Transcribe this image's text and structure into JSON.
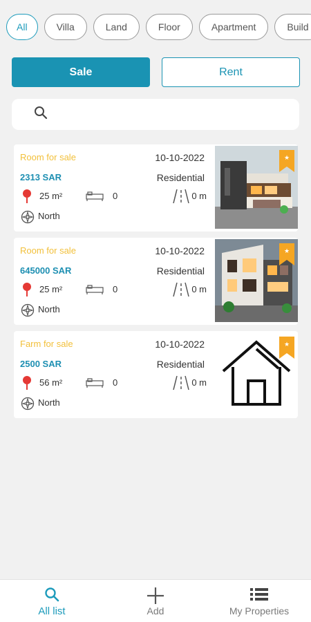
{
  "filters": {
    "chips": [
      "All",
      "Villa",
      "Land",
      "Floor",
      "Apartment",
      "Build"
    ],
    "active_index": 0
  },
  "toggle": {
    "sale_label": "Sale",
    "rent_label": "Rent",
    "selected": "Sale"
  },
  "search": {
    "placeholder": "",
    "icon": "search-icon"
  },
  "listings": [
    {
      "title": "Room for sale",
      "date": "10-10-2022",
      "price": "2313 SAR",
      "type": "Residential",
      "area": "25 m²",
      "bedrooms": "0",
      "street_width": "0 m",
      "direction": "North",
      "image": "modern-villa-photo"
    },
    {
      "title": "Room for sale",
      "date": "10-10-2022",
      "price": "645000 SAR",
      "type": "Residential",
      "area": "25 m²",
      "bedrooms": "0",
      "street_width": "0 m",
      "direction": "North",
      "image": "modern-house-photo"
    },
    {
      "title": "Farm for sale",
      "date": "10-10-2022",
      "price": "2500 SAR",
      "type": "Residential",
      "area": "56 m²",
      "bedrooms": "0",
      "street_width": "0 m",
      "direction": "North",
      "image": "house-placeholder-icon"
    }
  ],
  "bottom_nav": {
    "items": [
      {
        "label": "All list",
        "icon": "search-icon",
        "active": true
      },
      {
        "label": "Add",
        "icon": "plus-icon",
        "active": false
      },
      {
        "label": "My Properties",
        "icon": "list-icon",
        "active": false
      }
    ]
  },
  "colors": {
    "primary": "#1a93b3",
    "title_yellow": "#f2c03b",
    "price_blue": "#1d8fb2",
    "pin_red": "#e53935",
    "bookmark_orange": "#f5a623",
    "background": "#f1f1f1"
  }
}
